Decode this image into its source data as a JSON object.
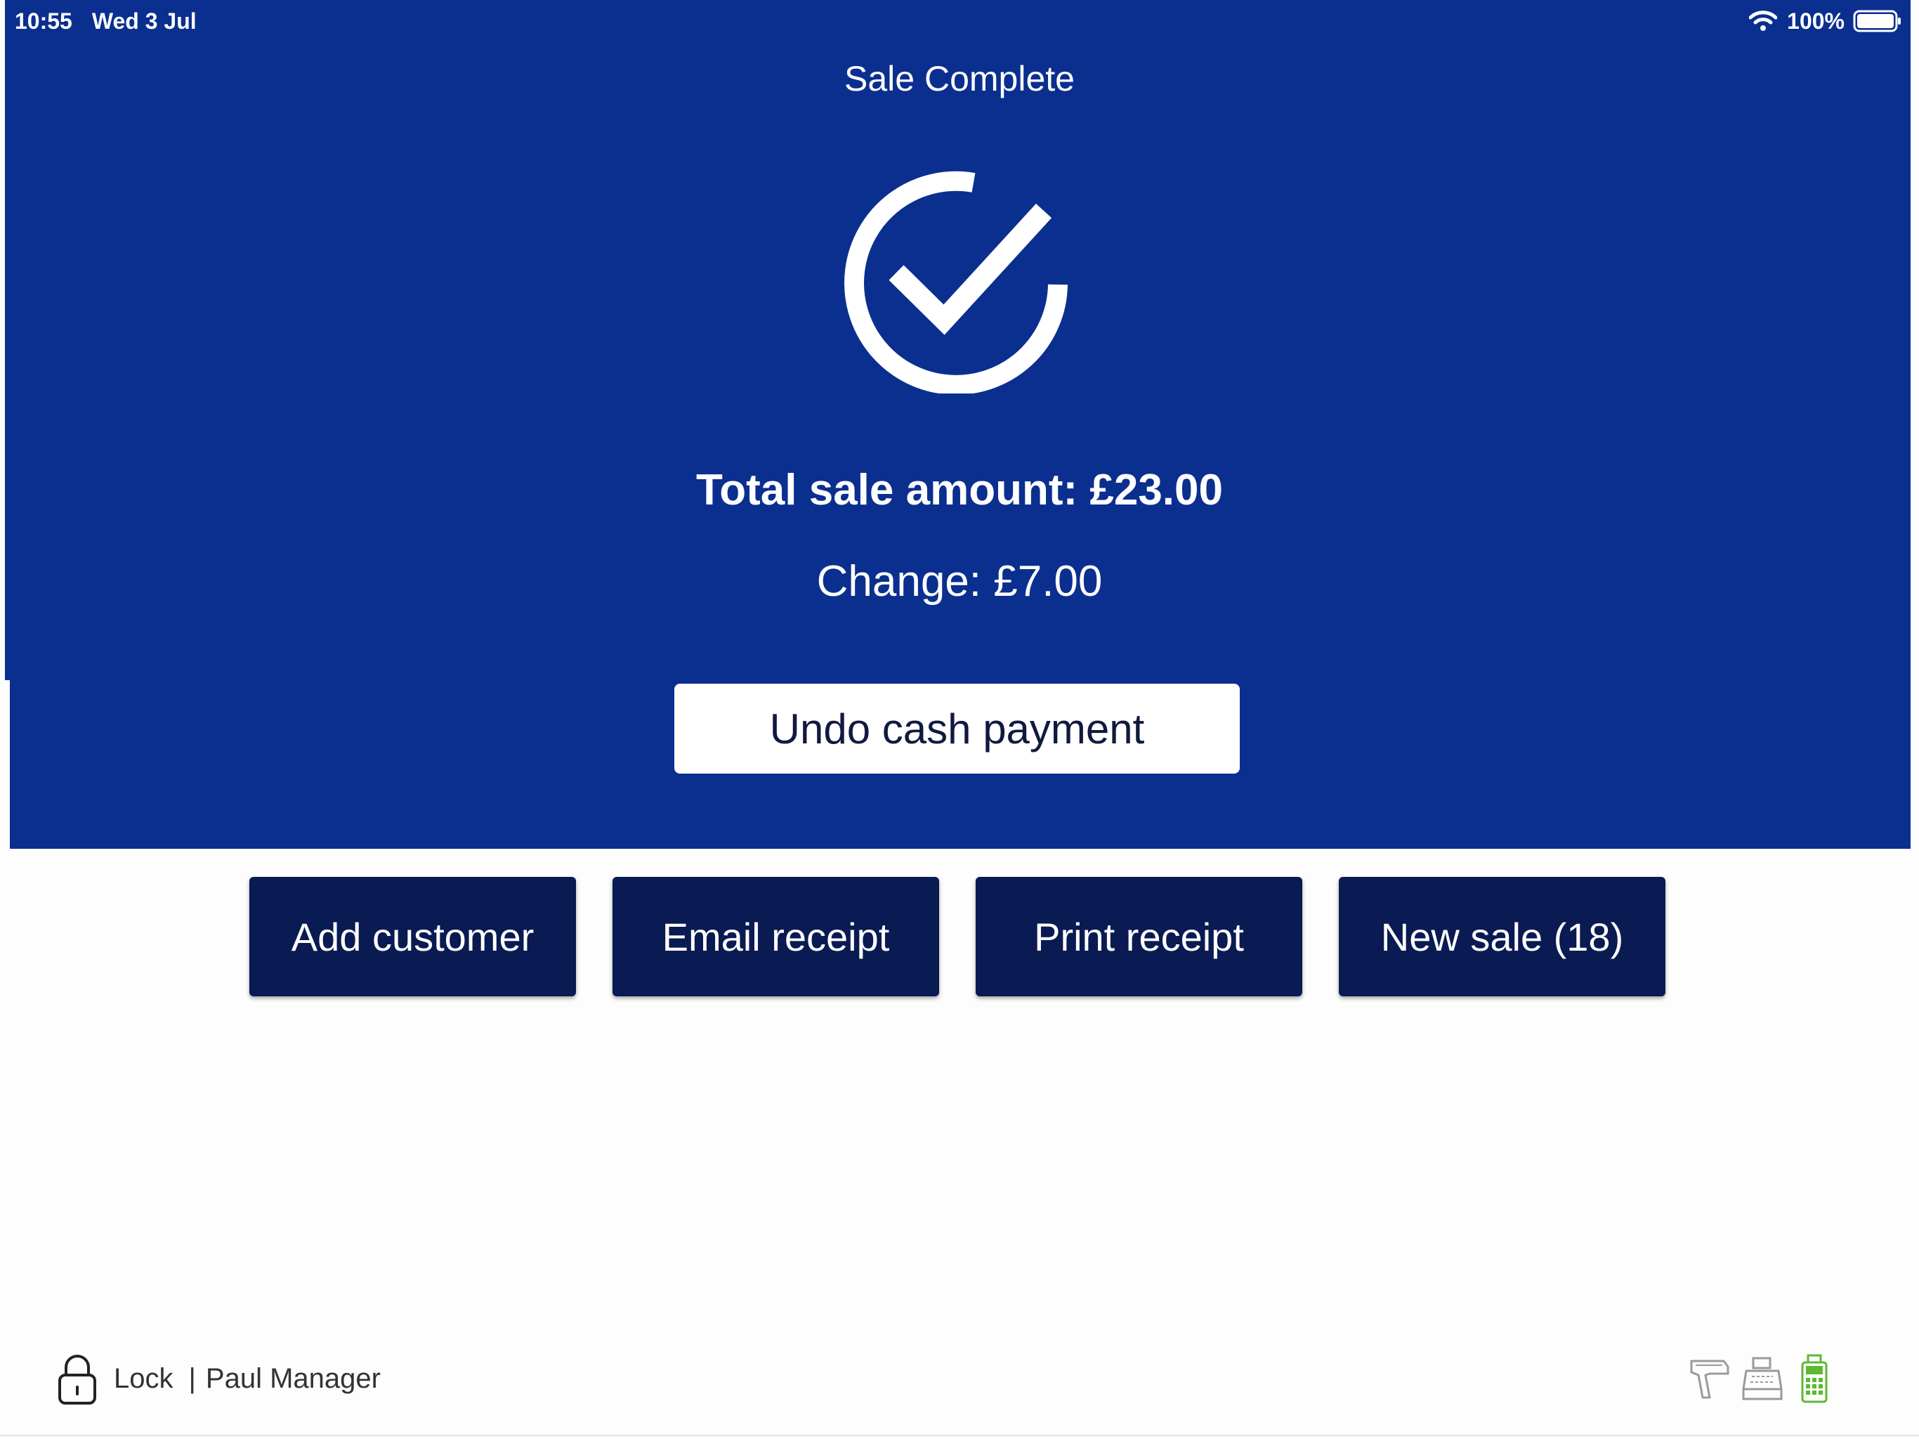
{
  "status_bar": {
    "time": "10:55",
    "date": "Wed 3 Jul",
    "battery": "100%",
    "icons": [
      "wifi-icon",
      "battery-icon"
    ]
  },
  "header": {
    "title": "Sale Complete",
    "status_icon": "check-circle-icon"
  },
  "summary": {
    "total": "Total sale amount: £23.00",
    "change": "Change: £7.00"
  },
  "undo_button": {
    "label": "Undo cash payment"
  },
  "actions": [
    {
      "label": "Add customer"
    },
    {
      "label": "Email receipt"
    },
    {
      "label": "Print receipt"
    },
    {
      "label": "New sale (18)"
    }
  ],
  "footer": {
    "lock_label": "Lock",
    "separator": "|",
    "user": "Paul Manager",
    "device_icons": [
      "barcode-scanner-icon",
      "cash-register-icon",
      "card-terminal-icon"
    ]
  },
  "colors": {
    "header_background": "#0b2f8f",
    "action_button": "#0a1a52",
    "terminal_connected": "#5fb833",
    "device_inactive": "#9a9a9a"
  }
}
